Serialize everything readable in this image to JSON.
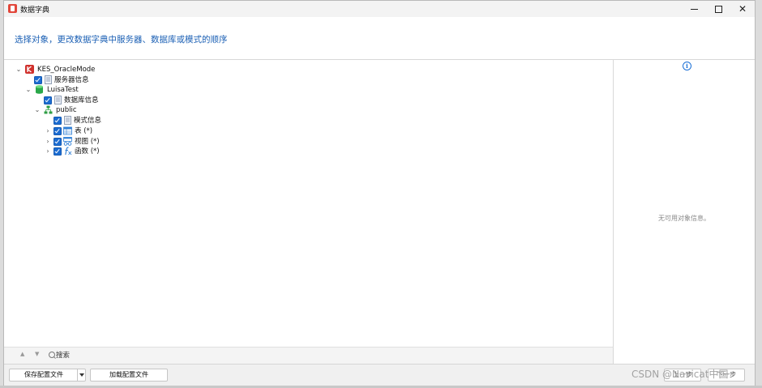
{
  "window": {
    "title": "数据字典",
    "minimize": "minimize",
    "maximize": "maximize",
    "close": "✕"
  },
  "header": {
    "instruction": "选择对象，更改数据字典中服务器、数据库或模式的顺序"
  },
  "tree": {
    "server": {
      "label": "KES_OracleMode",
      "expanded": true
    },
    "server_info": {
      "label": "服务器信息",
      "checked": true
    },
    "database": {
      "label": "LuisaTest",
      "expanded": true
    },
    "database_info": {
      "label": "数据库信息",
      "checked": true
    },
    "schema": {
      "label": "public",
      "expanded": true
    },
    "schema_info": {
      "label": "模式信息",
      "checked": true
    },
    "tables": {
      "label": "表 (*)",
      "checked": true
    },
    "views": {
      "label": "视图 (*)",
      "checked": true
    },
    "functions": {
      "label": "函数 (*)",
      "checked": true
    }
  },
  "info_panel": {
    "empty_text": "无可用对象信息。"
  },
  "search": {
    "placeholder": "搜索",
    "up_arrow": "▲",
    "down_arrow": "▼"
  },
  "footer": {
    "save_label": "保存配置文件",
    "load_label": "加载配置文件",
    "prev_label": "上一步",
    "next_label": "下一步"
  },
  "watermark": "CSDN @Navicat中国",
  "colors": {
    "accent": "#1c6cd1",
    "instruction": "#1a5fb4",
    "server_icon": "#d0312d",
    "database_icon": "#2aa84a",
    "schema_icon": "#2f9e44"
  }
}
